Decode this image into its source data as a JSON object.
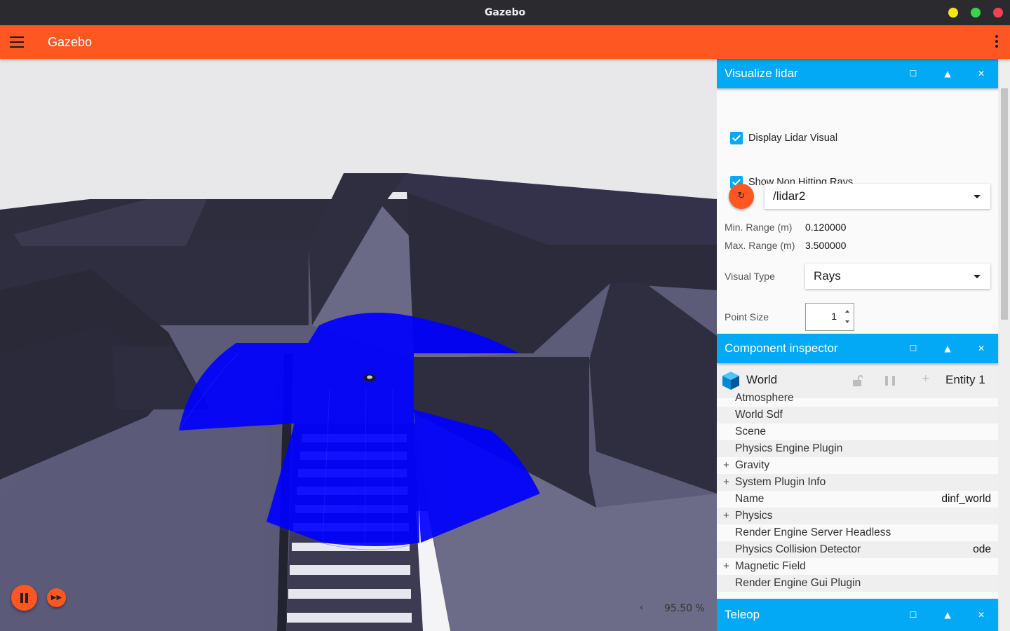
{
  "window": {
    "title": "Gazebo",
    "controls": {
      "minimize_color": "#f4e51d",
      "maximize_color": "#3ad34a",
      "close_color": "#f1424f"
    }
  },
  "appbar": {
    "title": "Gazebo",
    "color": "#fe5722"
  },
  "viewport": {
    "rtf_arrow": "‹",
    "rtf": "95.50 %",
    "lidar_color": "#0000ff"
  },
  "lidar_panel": {
    "title": "Visualize lidar",
    "display_lidar_visual": {
      "label": "Display Lidar Visual",
      "checked": true
    },
    "show_non_hitting_rays": {
      "label": "Show Non Hitting Rays",
      "checked": true
    },
    "refresh_icon": "↻",
    "topic": "/lidar2",
    "min_range_label": "Min. Range (m)",
    "min_range_value": "0.120000",
    "max_range_label": "Max. Range (m)",
    "max_range_value": "3.500000",
    "visual_type_label": "Visual Type",
    "visual_type_value": "Rays",
    "point_size_label": "Point Size",
    "point_size_value": "1"
  },
  "component_inspector": {
    "title": "Component inspector",
    "world_label": "World",
    "add_icon": "+",
    "entity_label": "Entity 1",
    "rows": [
      {
        "name": "Atmosphere",
        "expandable": false,
        "value": ""
      },
      {
        "name": "World Sdf",
        "expandable": false,
        "value": ""
      },
      {
        "name": "Scene",
        "expandable": false,
        "value": ""
      },
      {
        "name": "Physics Engine Plugin",
        "expandable": false,
        "value": ""
      },
      {
        "name": "Gravity",
        "expandable": true,
        "value": ""
      },
      {
        "name": "System Plugin Info",
        "expandable": true,
        "value": ""
      },
      {
        "name": "Name",
        "expandable": false,
        "value": "dinf_world"
      },
      {
        "name": "Physics",
        "expandable": true,
        "value": ""
      },
      {
        "name": "Render Engine Server Headless",
        "expandable": false,
        "value": ""
      },
      {
        "name": "Physics Collision Detector",
        "expandable": false,
        "value": "ode"
      },
      {
        "name": "Magnetic Field",
        "expandable": true,
        "value": ""
      },
      {
        "name": "Render Engine Gui Plugin",
        "expandable": false,
        "value": ""
      }
    ],
    "expand_symbol": "+"
  },
  "teleop_panel": {
    "title": "Teleop"
  },
  "panel_buttons": {
    "maximize": "☐",
    "collapse": "▲",
    "close": "✕"
  },
  "colors": {
    "accent": "#fe5722",
    "panel_header": "#03a9f4"
  }
}
